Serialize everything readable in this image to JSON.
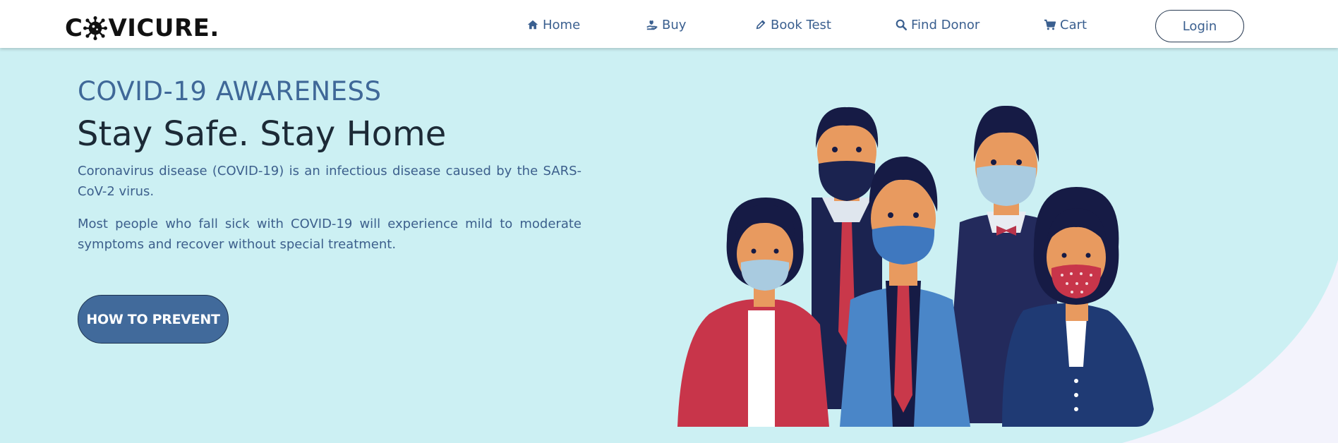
{
  "brand": {
    "logo_prefix": "C",
    "logo_suffix": "VICURE."
  },
  "nav": {
    "items": [
      {
        "label": "Home",
        "icon": "home-icon"
      },
      {
        "label": "Buy",
        "icon": "hand-holding-icon"
      },
      {
        "label": "Book Test",
        "icon": "pencil-icon"
      },
      {
        "label": "Find Donor",
        "icon": "search-icon"
      },
      {
        "label": "Cart",
        "icon": "cart-icon"
      }
    ],
    "login_label": "Login"
  },
  "hero": {
    "kicker": "COVID-19 AWARENESS",
    "headline": "Stay Safe. Stay Home",
    "paragraph_1": "Coronavirus disease (COVID-19) is an infectious disease caused by the SARS-CoV-2 virus.",
    "paragraph_2": "Most people who fall sick with COVID-19 will experience mild to moderate symptoms and recover without special treatment.",
    "cta_label": "HOW TO PREVENT"
  },
  "colors": {
    "hero_background": "#ccf0f3",
    "page_background": "#f3f3fc",
    "accent": "#416a9b",
    "nav_text": "#3a5f8f",
    "headline": "#1c2a36"
  }
}
